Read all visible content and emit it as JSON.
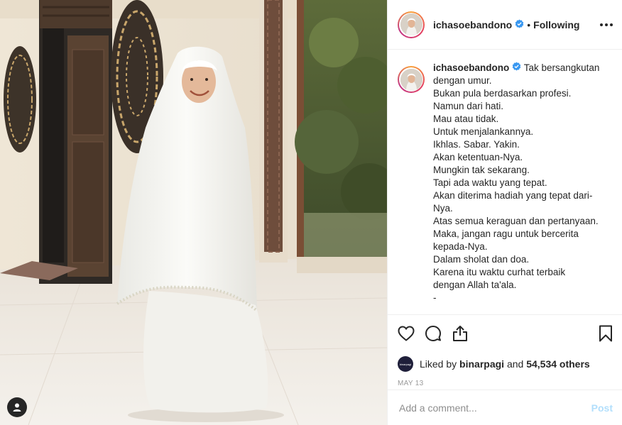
{
  "post": {
    "username": "ichasoebandono",
    "follow_status": "Following",
    "separator": "•",
    "caption_lines": [
      "Tak bersangkutan",
      "dengan umur.",
      "Bukan pula berdasarkan profesi.",
      "Namun dari hati.",
      "Mau atau tidak.",
      "Untuk menjalankannya.",
      "Ikhlas. Sabar. Yakin.",
      "Akan ketentuan-Nya.",
      "Mungkin tak sekarang.",
      "Tapi ada waktu yang tepat.",
      "Akan diterima hadiah yang tepat dari-",
      "Nya.",
      "Atas semua keraguan dan pertanyaan.",
      "Maka, jangan ragu untuk bercerita",
      "kepada-Nya.",
      "Dalam sholat dan doa.",
      "Karena itu waktu curhat terbaik",
      "dengan Allah ta'ala.",
      "-"
    ],
    "liked_by_prefix": "Liked by",
    "liked_by_user": "binarpagi",
    "liked_by_and": "and",
    "liked_by_count": "54,534 others",
    "liker_avatar_text": "binarpagi",
    "date": "MAY 13"
  },
  "comment": {
    "placeholder": "Add a comment...",
    "post_label": "Post"
  },
  "icons": {
    "verified": "verified-badge-icon",
    "more": "more-options-icon",
    "like": "heart-icon",
    "comment": "comment-bubble-icon",
    "share": "share-icon",
    "save": "bookmark-icon",
    "tag": "user-tag-icon"
  },
  "colors": {
    "verified_blue": "#3897f0",
    "post_disabled": "#b2dffc",
    "text": "#262626",
    "muted": "#999999"
  }
}
